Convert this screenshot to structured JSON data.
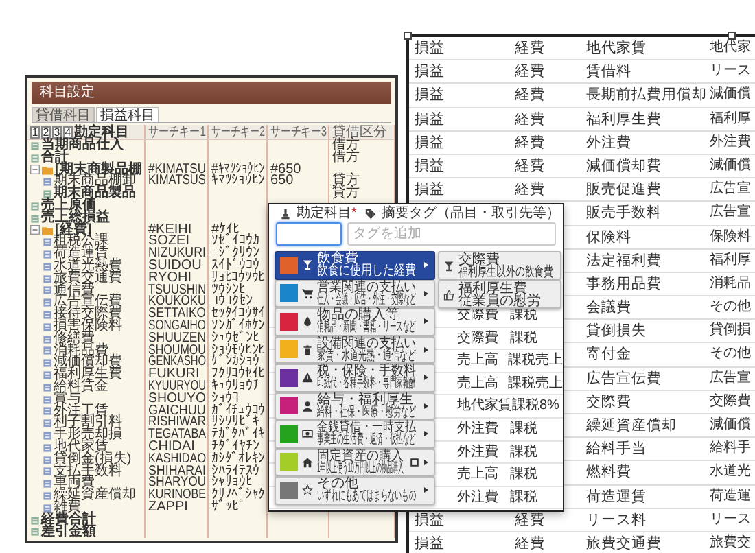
{
  "account_window": {
    "title": "科目設定",
    "tabs": [
      {
        "label": "貸借科目",
        "selected": false
      },
      {
        "label": "損益科目",
        "selected": true
      }
    ],
    "levels": [
      "1",
      "2",
      "3",
      "4"
    ],
    "columns": [
      "勘定科目",
      "サーチキー1",
      "サーチキー2",
      "サーチキー3",
      "貸借区分"
    ],
    "rows": [
      {
        "kind": "total",
        "name": "当期商品仕入",
        "side": "借方"
      },
      {
        "kind": "total",
        "name": "合計",
        "side": "借方"
      },
      {
        "kind": "group",
        "name": "[期末商製品棚",
        "key1": "#KIMATSU",
        "key2": "#ｷﾏﾂｼｮｳﾋﾝ",
        "key3": "#650",
        "expanded": true,
        "children": [
          {
            "kind": "account",
            "name": "期末商品棚卸",
            "key1": "KIMATSUS",
            "key2": "ｷﾏﾂｼｮｳﾋﾝ",
            "key3": "650",
            "side": "貸方"
          },
          {
            "kind": "total",
            "name": "期末商品製品",
            "side": "貸方"
          }
        ]
      },
      {
        "kind": "total",
        "name": "売上原価"
      },
      {
        "kind": "total",
        "name": "売上総損益"
      },
      {
        "kind": "group",
        "name": "[経費]",
        "key1": "#KEIHI",
        "key2": "#ｹｲﾋ",
        "expanded": true,
        "children": [
          {
            "kind": "account",
            "name": "租税公課",
            "key1": "SOZEI",
            "key2": "ｿｾﾞｲｺｳｶ"
          },
          {
            "kind": "account",
            "name": "荷造運賃",
            "key1": "NIZUKURI",
            "key2": "ﾆｼﾞｸﾘｳﾝ"
          },
          {
            "kind": "account",
            "name": "水道光熱費",
            "key1": "SUIDOU",
            "key2": "ｽｲﾄﾞｳｺｳ"
          },
          {
            "kind": "account",
            "name": "旅費交通費",
            "key1": "RYOHI",
            "key2": "ﾘｮﾋｺｳﾂｳﾋ"
          },
          {
            "kind": "account",
            "name": "通信費",
            "key1": "TSUUSHIN",
            "key2": "ﾂｳｼﾝﾋ"
          },
          {
            "kind": "account",
            "name": "広告宣伝費",
            "key1": "KOUKOKU",
            "key2": "ｺｳｺｸｾﾝ"
          },
          {
            "kind": "account",
            "name": "接待交際費",
            "key1": "SETTAIKO",
            "key2": "ｾｯﾀｲｺｳｻｲ"
          },
          {
            "kind": "account",
            "name": "損害保険料",
            "key1": "SONGAIHO",
            "key2": "ｿﾝｶﾞｲﾎｹﾝ"
          },
          {
            "kind": "account",
            "name": "修繕費",
            "key1": "SHUUZEN",
            "key2": "ｼｭｳｾﾞﾝﾋ"
          },
          {
            "kind": "account",
            "name": "消耗品費",
            "key1": "SHOUMOU",
            "key2": "ｼｮｳﾓｳﾋﾝﾋ"
          },
          {
            "kind": "account",
            "name": "減価償却費",
            "key1": "GENKASHO",
            "key2": "ｹﾞﾝｶｼｮｳ"
          },
          {
            "kind": "account",
            "name": "福利厚生費",
            "key1": "FUKURI",
            "key2": "ﾌｸﾘｺｳｾｲﾋ"
          },
          {
            "kind": "account",
            "name": "給料賃金",
            "key1": "KYUURYOU",
            "key2": "ｷｭｳﾘｮｳﾁ"
          },
          {
            "kind": "account",
            "name": "賞与",
            "key1": "SHOUYO",
            "key2": "ｼｮｳﾖ"
          },
          {
            "kind": "account",
            "name": "外注工賃",
            "key1": "GAICHUU",
            "key2": "ｶﾞｲﾁｭｳｺｳ"
          },
          {
            "kind": "account",
            "name": "利子割引料",
            "key1": "RISHIWAR",
            "key2": "ﾘｼﾜﾘﾋﾞｷ"
          },
          {
            "kind": "account",
            "name": "手形売却損",
            "key1": "TEGATABA",
            "key2": "ﾃｶﾞﾀﾊﾞｲｷ"
          },
          {
            "kind": "account",
            "name": "地代家賃",
            "key1": "CHIDAI",
            "key2": "ﾁﾀﾞｲﾔﾁﾝ"
          },
          {
            "kind": "account",
            "name": "貸倒金(損失)",
            "key1": "KASHIDAO",
            "key2": "ｶｼﾀﾞｵﾚｷﾝ"
          },
          {
            "kind": "account",
            "name": "支払手数料",
            "key1": "SHIHARAI",
            "key2": "ｼﾊﾗｲﾃｽｳ"
          },
          {
            "kind": "account",
            "name": "車両費",
            "key1": "SHARYOU",
            "key2": "ｼｬﾘｮｳﾋ"
          },
          {
            "kind": "account",
            "name": "繰延資産償却",
            "key1": "KURINOBE",
            "key2": "ｸﾘﾉﾍﾞｼｬｸ"
          },
          {
            "kind": "account",
            "name": "雑費",
            "key1": "ZAPPI",
            "key2": "ｻﾞｯﾋﾟ"
          }
        ]
      },
      {
        "kind": "total",
        "name": "経費合計"
      },
      {
        "kind": "total",
        "name": "差引金額"
      }
    ]
  },
  "journal_table": {
    "rows": [
      {
        "c1": "損益",
        "c3": "経費",
        "c4": "地代家賃",
        "c5": "地代家"
      },
      {
        "c1": "損益",
        "c3": "経費",
        "c4": "賃借料",
        "c5": "リース"
      },
      {
        "c1": "損益",
        "c3": "経費",
        "c4": "長期前払費用償却",
        "c5": "減価償"
      },
      {
        "c1": "損益",
        "c3": "経費",
        "c4": "福利厚生費",
        "c5": "福利厚"
      },
      {
        "c1": "損益",
        "c3": "経費",
        "c4": "外注費",
        "c5": "外注費"
      },
      {
        "c1": "損益",
        "c3": "経費",
        "c4": "減価償却費",
        "c5": "減価償"
      },
      {
        "c1": "損益",
        "c3": "経費",
        "c4": "販売促進費",
        "c5": "広告宣"
      },
      {
        "c4": "販売手数料",
        "c5": "広告宣"
      },
      {
        "c4": "保険料",
        "c5": "保険料"
      },
      {
        "c4": "法定福利費",
        "c5": "福利厚"
      },
      {
        "c4": "事務用品費",
        "c5": "消耗品"
      },
      {
        "c4": "会議費",
        "c5": "その他"
      },
      {
        "c4": "貸倒損失",
        "c5": "貸倒損"
      },
      {
        "c4": "寄付金",
        "c5": "その他"
      },
      {
        "c4": "広告宣伝費",
        "c5": "広告宣"
      },
      {
        "c4": "交際費",
        "c5": "交際費"
      },
      {
        "c4": "繰延資産償却",
        "c5": "減価償"
      },
      {
        "c4": "給料手当",
        "c5": "給料手"
      },
      {
        "c4": "燃料費",
        "c5": "水道光"
      },
      {
        "c4": "荷造運賃",
        "c5": "荷造運"
      },
      {
        "c1": "損益",
        "c3": "経費",
        "c4": "リース料",
        "c5": "リース"
      },
      {
        "c1": "損益",
        "c3": "経費",
        "c4": "旅費交通費",
        "c5": "旅費交"
      }
    ]
  },
  "entry_popup": {
    "account_label": "勘定科目",
    "required_mark": "*",
    "tag_label": "摘要タグ（品目・取引先等）",
    "account_input": {
      "focused": true
    },
    "tag_input": {
      "placeholder": "タグを追加"
    },
    "rows": [
      {
        "category": "交際費",
        "tax": "課税"
      },
      {
        "category": "交際費",
        "tax": "課税"
      },
      {
        "category": "売上高",
        "tax": "課税売上"
      },
      {
        "category": "売上高",
        "tax": "課税売上"
      },
      {
        "category": "地代家賃",
        "tax": "課税8%"
      },
      {
        "category": "外注費",
        "tax": "課税"
      },
      {
        "category": "外注費",
        "tax": "課税"
      },
      {
        "category": "売上高",
        "tax": "課税"
      },
      {
        "category": "外注費",
        "tax": "課税"
      }
    ],
    "menu": [
      {
        "title": "飲食費",
        "subtitle": "飲食に使用した経費",
        "color": "#e0622a",
        "selected": true
      },
      {
        "title": "営業関連の支払い",
        "subtitle": "仕入・会議・広告・外注・交際など",
        "color": "#1a86c9",
        "selected": false
      },
      {
        "title": "物品の購入等",
        "subtitle": "消耗品・新聞・書籍・リースなど",
        "color": "#d8253f",
        "selected": false
      },
      {
        "title": "設備関連の支払い",
        "subtitle": "家賃・水道光熱・通信など",
        "color": "#f2b01c",
        "selected": false
      },
      {
        "title": "税・保険・手数料",
        "subtitle": "印紙代・各種手数料・専門家報酬",
        "color": "#6b2fa0",
        "selected": false
      },
      {
        "title": "給与・福利厚生",
        "subtitle": "給料・社保・医療・慰労など",
        "color": "#c7207a",
        "selected": false
      },
      {
        "title": "金銭貸借・一時支払",
        "subtitle": "事業主の生活費・返済・仮払など",
        "color": "#23a31e",
        "selected": false
      },
      {
        "title": "固定資産の購入",
        "subtitle": "1年以上使う10万円以上の物品購入",
        "color": "#a5cd28",
        "selected": false
      },
      {
        "title": "その他",
        "subtitle": "いずれにもあてはまらないもの",
        "color": "#777777",
        "selected": false
      }
    ],
    "submenu": [
      {
        "title": "交際費",
        "subtitle": "福利厚生以外の飲食費"
      },
      {
        "title": "福利厚生費",
        "subtitle": "従業員の慰労"
      }
    ]
  }
}
